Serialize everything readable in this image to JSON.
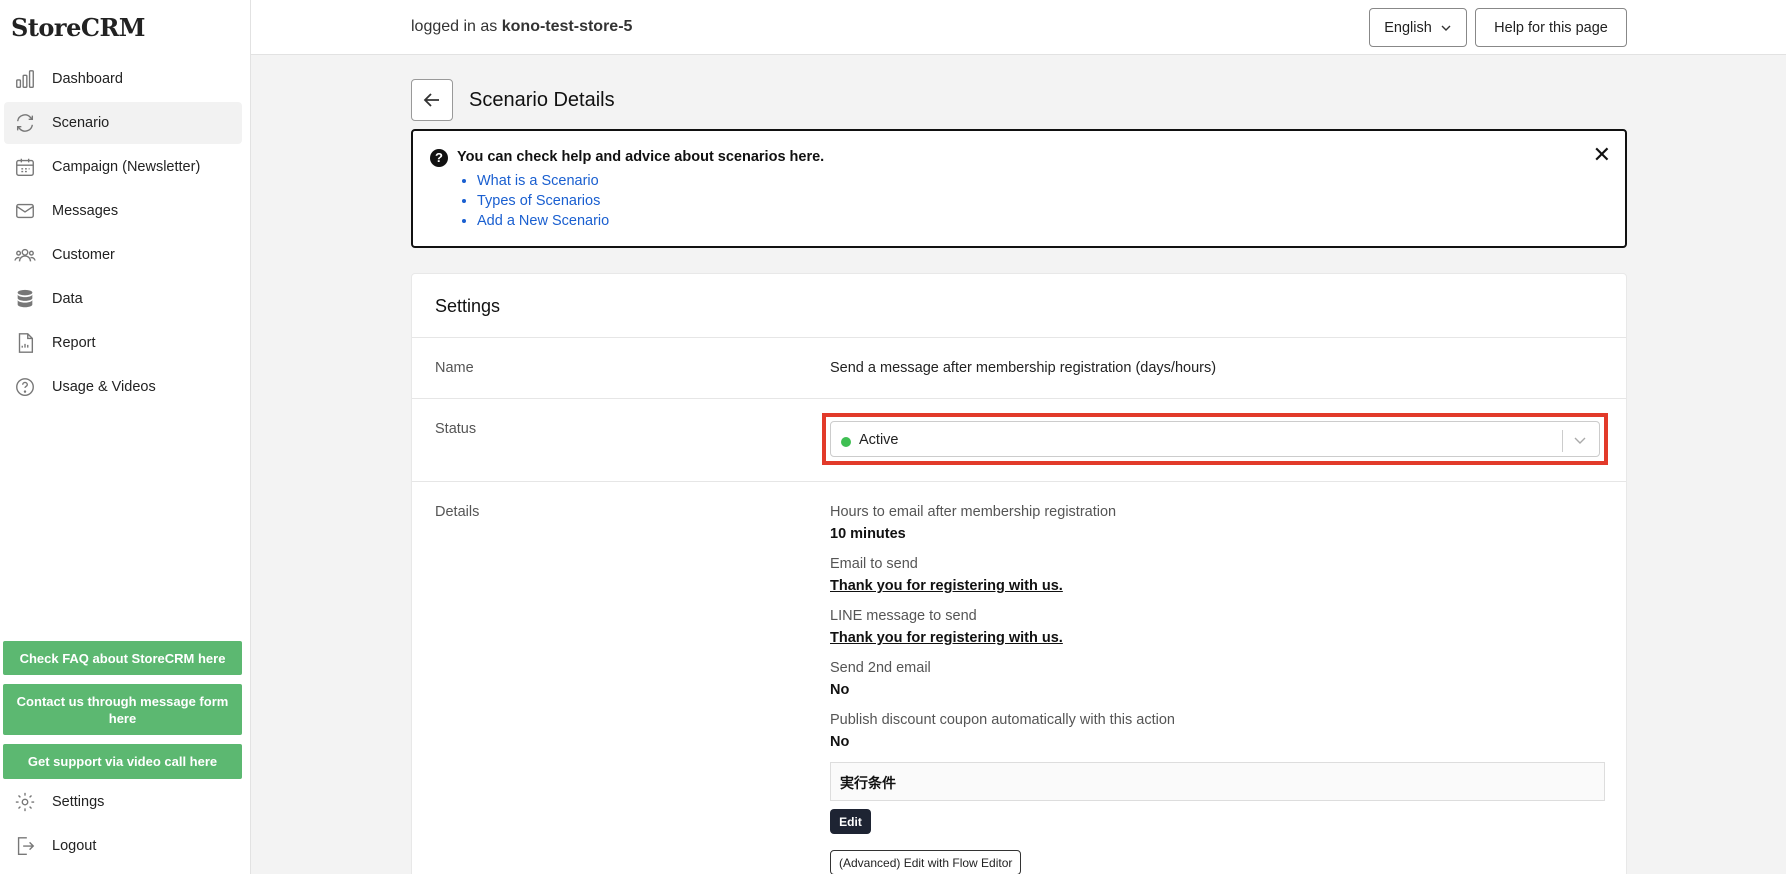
{
  "app": {
    "logo": "StoreCRM"
  },
  "sidebar": {
    "items": [
      {
        "label": "Dashboard",
        "icon": "bar-chart-icon"
      },
      {
        "label": "Scenario",
        "icon": "refresh-icon",
        "active": true
      },
      {
        "label": "Campaign (Newsletter)",
        "icon": "calendar-icon"
      },
      {
        "label": "Messages",
        "icon": "envelope-icon"
      },
      {
        "label": "Customer",
        "icon": "users-icon"
      },
      {
        "label": "Data",
        "icon": "database-icon"
      },
      {
        "label": "Report",
        "icon": "document-icon"
      },
      {
        "label": "Usage & Videos",
        "icon": "question-circle-icon"
      }
    ],
    "support_buttons": [
      "Check FAQ about StoreCRM here",
      "Contact us through message form here",
      "Get support via video call here"
    ],
    "bottom_items": [
      {
        "label": "Settings",
        "icon": "gear-icon"
      },
      {
        "label": "Logout",
        "icon": "logout-icon"
      }
    ]
  },
  "topbar": {
    "logged_prefix": "logged in as",
    "username": "kono-test-store-5",
    "language": "English",
    "help_button": "Help for this page"
  },
  "page": {
    "title": "Scenario Details"
  },
  "help": {
    "title": "You can check help and advice about scenarios here.",
    "links": [
      "What is a Scenario",
      "Types of Scenarios",
      "Add a New Scenario"
    ]
  },
  "settings": {
    "title": "Settings",
    "name_label": "Name",
    "name_value": "Send a message after membership registration (days/hours)",
    "status_label": "Status",
    "status_value": "Active",
    "details_label": "Details",
    "details": [
      {
        "label": "Hours to email after membership registration",
        "value": "10 minutes",
        "link": false
      },
      {
        "label": "Email to send",
        "value": "Thank you for registering with us.",
        "link": true
      },
      {
        "label": "LINE message to send",
        "value": "Thank you for registering with us.",
        "link": true
      },
      {
        "label": "Send 2nd email",
        "value": "No",
        "link": false
      },
      {
        "label": "Publish discount coupon automatically with this action",
        "value": "No",
        "link": false
      }
    ],
    "condition_title": "実行条件",
    "edit_button": "Edit",
    "flow_button": "(Advanced) Edit with Flow Editor"
  },
  "colors": {
    "accent_green": "#5cb871",
    "highlight_red": "#e23a2a",
    "status_green": "#3fbf53",
    "link_blue": "#1a5fd0"
  }
}
